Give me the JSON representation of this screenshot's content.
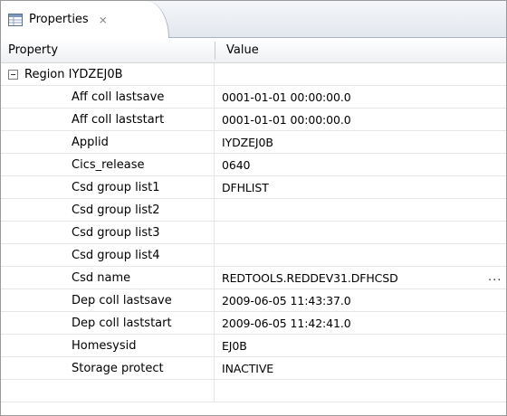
{
  "tab": {
    "icon": "properties-table-icon",
    "label": "Properties",
    "close_glyph": "⨯"
  },
  "columns": {
    "property": "Property",
    "value": "Value"
  },
  "group": {
    "label": "Region IYDZEJ0B"
  },
  "rows": [
    {
      "property": "Aff coll lastsave",
      "value": "0001-01-01 00:00:00.0"
    },
    {
      "property": "Aff coll laststart",
      "value": "0001-01-01 00:00:00.0"
    },
    {
      "property": "Applid",
      "value": "IYDZEJ0B"
    },
    {
      "property": "Cics_release",
      "value": "0640"
    },
    {
      "property": "Csd group list1",
      "value": "DFHLIST"
    },
    {
      "property": "Csd group list2",
      "value": ""
    },
    {
      "property": "Csd group list3",
      "value": ""
    },
    {
      "property": "Csd group list4",
      "value": ""
    },
    {
      "property": "Csd name",
      "value": "REDTOOLS.REDDEV31.DFHCSD",
      "more": "..."
    },
    {
      "property": "Dep coll lastsave",
      "value": "2009-06-05 11:43:37.0"
    },
    {
      "property": "Dep coll laststart",
      "value": "2009-06-05 11:42:41.0"
    },
    {
      "property": "Homesysid",
      "value": "EJ0B"
    },
    {
      "property": "Storage protect",
      "value": "INACTIVE"
    }
  ]
}
